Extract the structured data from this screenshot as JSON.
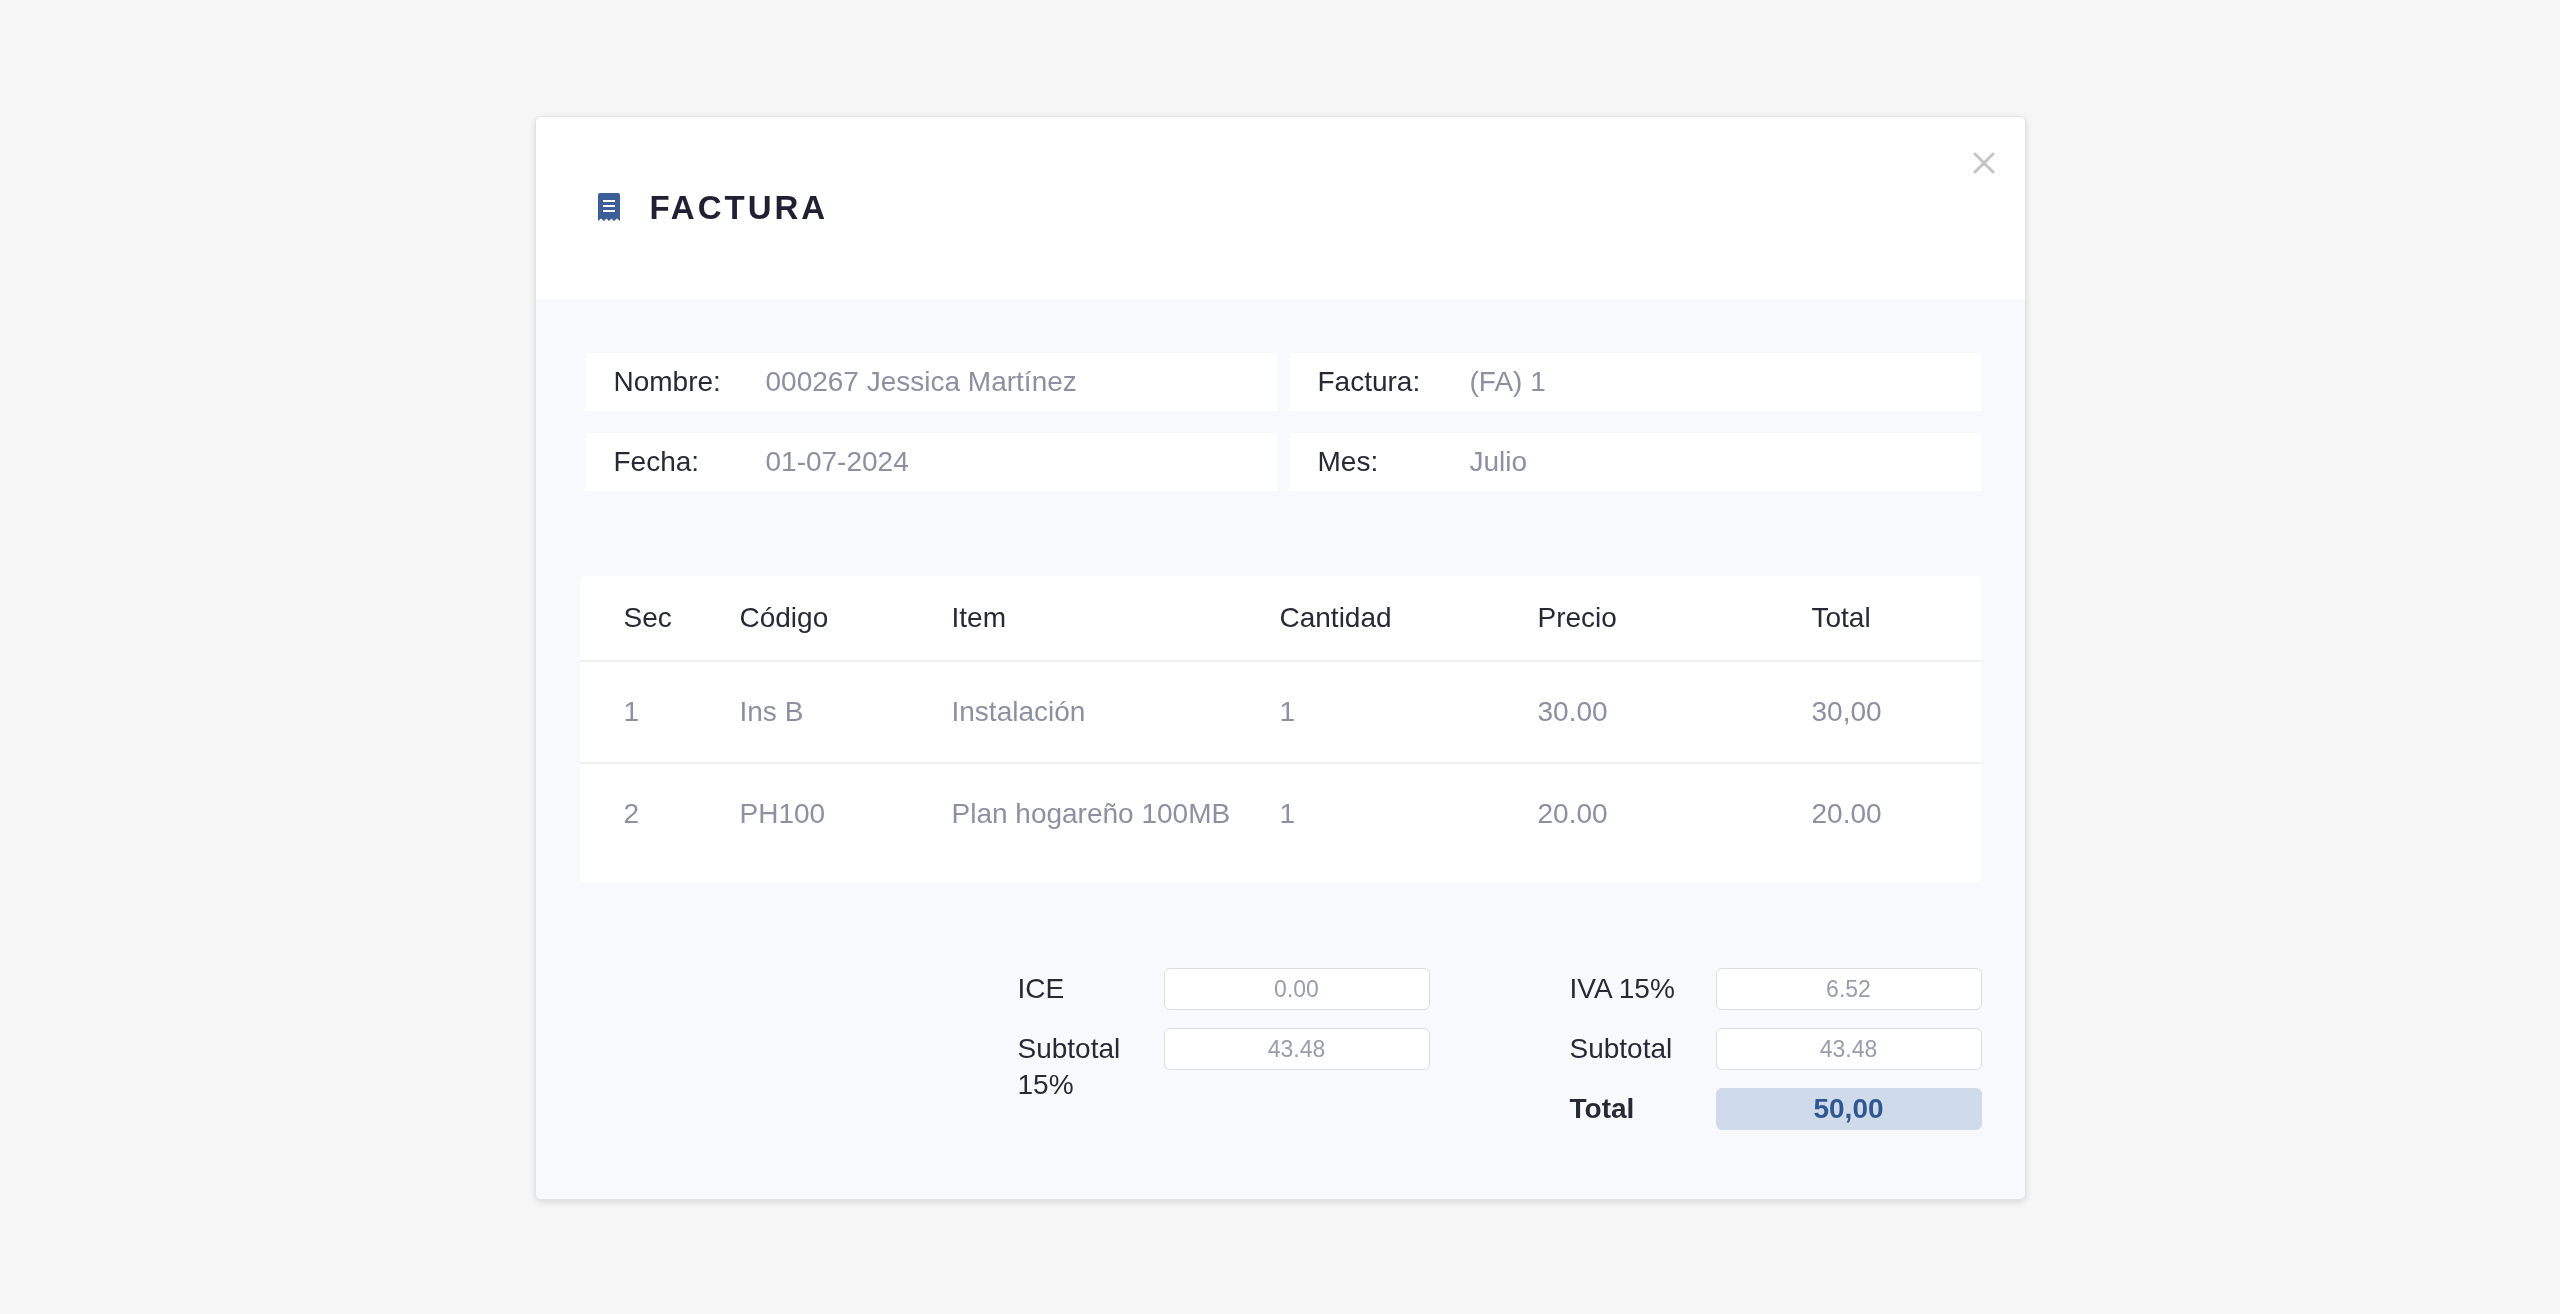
{
  "dialog": {
    "title": "FACTURA"
  },
  "info": [
    {
      "label": "Nombre:",
      "value": "000267 Jessica Martínez"
    },
    {
      "label": "Factura:",
      "value": "(FA) 1"
    },
    {
      "label": "Fecha:",
      "value": "01-07-2024"
    },
    {
      "label": "Mes:",
      "value": "Julio"
    }
  ],
  "table": {
    "columns": [
      "Sec",
      "Código",
      "Item",
      "Cantidad",
      "Precio",
      "Total"
    ],
    "rows": [
      [
        "1",
        "Ins B",
        "Instalación",
        "1",
        "30.00",
        "30,00"
      ],
      [
        "2",
        "PH100",
        "Plan hogareño 100MB",
        "1",
        "20.00",
        "20.00"
      ]
    ]
  },
  "totals": [
    [
      {
        "kind": "field",
        "label": "ICE",
        "value": "0.00"
      },
      {
        "kind": "field",
        "label": "Subtotal 15%",
        "value": "43.48"
      }
    ],
    [
      {
        "kind": "field",
        "label": "IVA 15%",
        "value": "6.52"
      },
      {
        "kind": "field",
        "label": "Subtotal",
        "value": "43.48"
      },
      {
        "kind": "total",
        "label": "Total",
        "value": "50,00"
      }
    ]
  ]
}
